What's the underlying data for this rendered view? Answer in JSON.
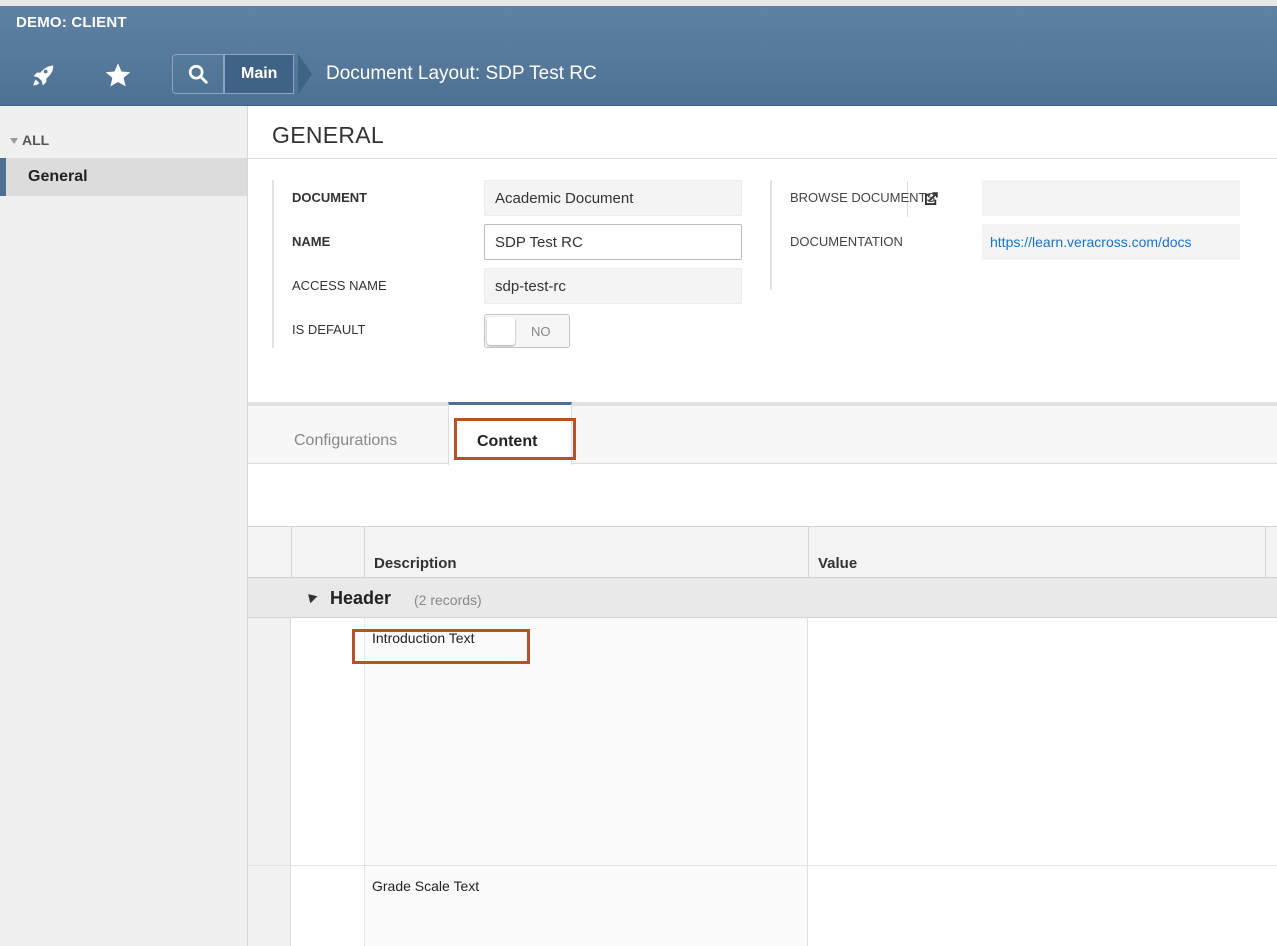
{
  "topbar": {
    "app_title": "DEMO: CLIENT",
    "breadcrumb_main": "Main",
    "page_title": "Document Layout: SDP Test RC"
  },
  "sidebar": {
    "all_label": "ALL",
    "items": [
      {
        "label": "General",
        "selected": true
      }
    ]
  },
  "section": {
    "title": "GENERAL"
  },
  "form": {
    "document_label": "DOCUMENT",
    "document_value": "Academic Document",
    "name_label": "NAME",
    "name_value": "SDP Test RC",
    "access_label": "ACCESS NAME",
    "access_value": "sdp-test-rc",
    "default_label": "IS DEFAULT",
    "default_value": "NO",
    "browse_label": "BROWSE DOCUMENTS",
    "browse_value": "",
    "doc_label": "DOCUMENTATION",
    "doc_link": "https://learn.veracross.com/docs"
  },
  "tabs": {
    "configurations": "Configurations",
    "content": "Content",
    "active": "Content"
  },
  "grid": {
    "columns": [
      "Description",
      "Value"
    ],
    "group": {
      "name": "Header",
      "count": "(2 records)"
    },
    "rows": [
      {
        "description": "Introduction Text",
        "value": ""
      },
      {
        "description": "Grade Scale Text",
        "value": ""
      }
    ]
  },
  "colors": {
    "topbar": "#5276999",
    "accent": "#4d7194",
    "highlight": "#b6522a",
    "link": "#1a73c7"
  }
}
